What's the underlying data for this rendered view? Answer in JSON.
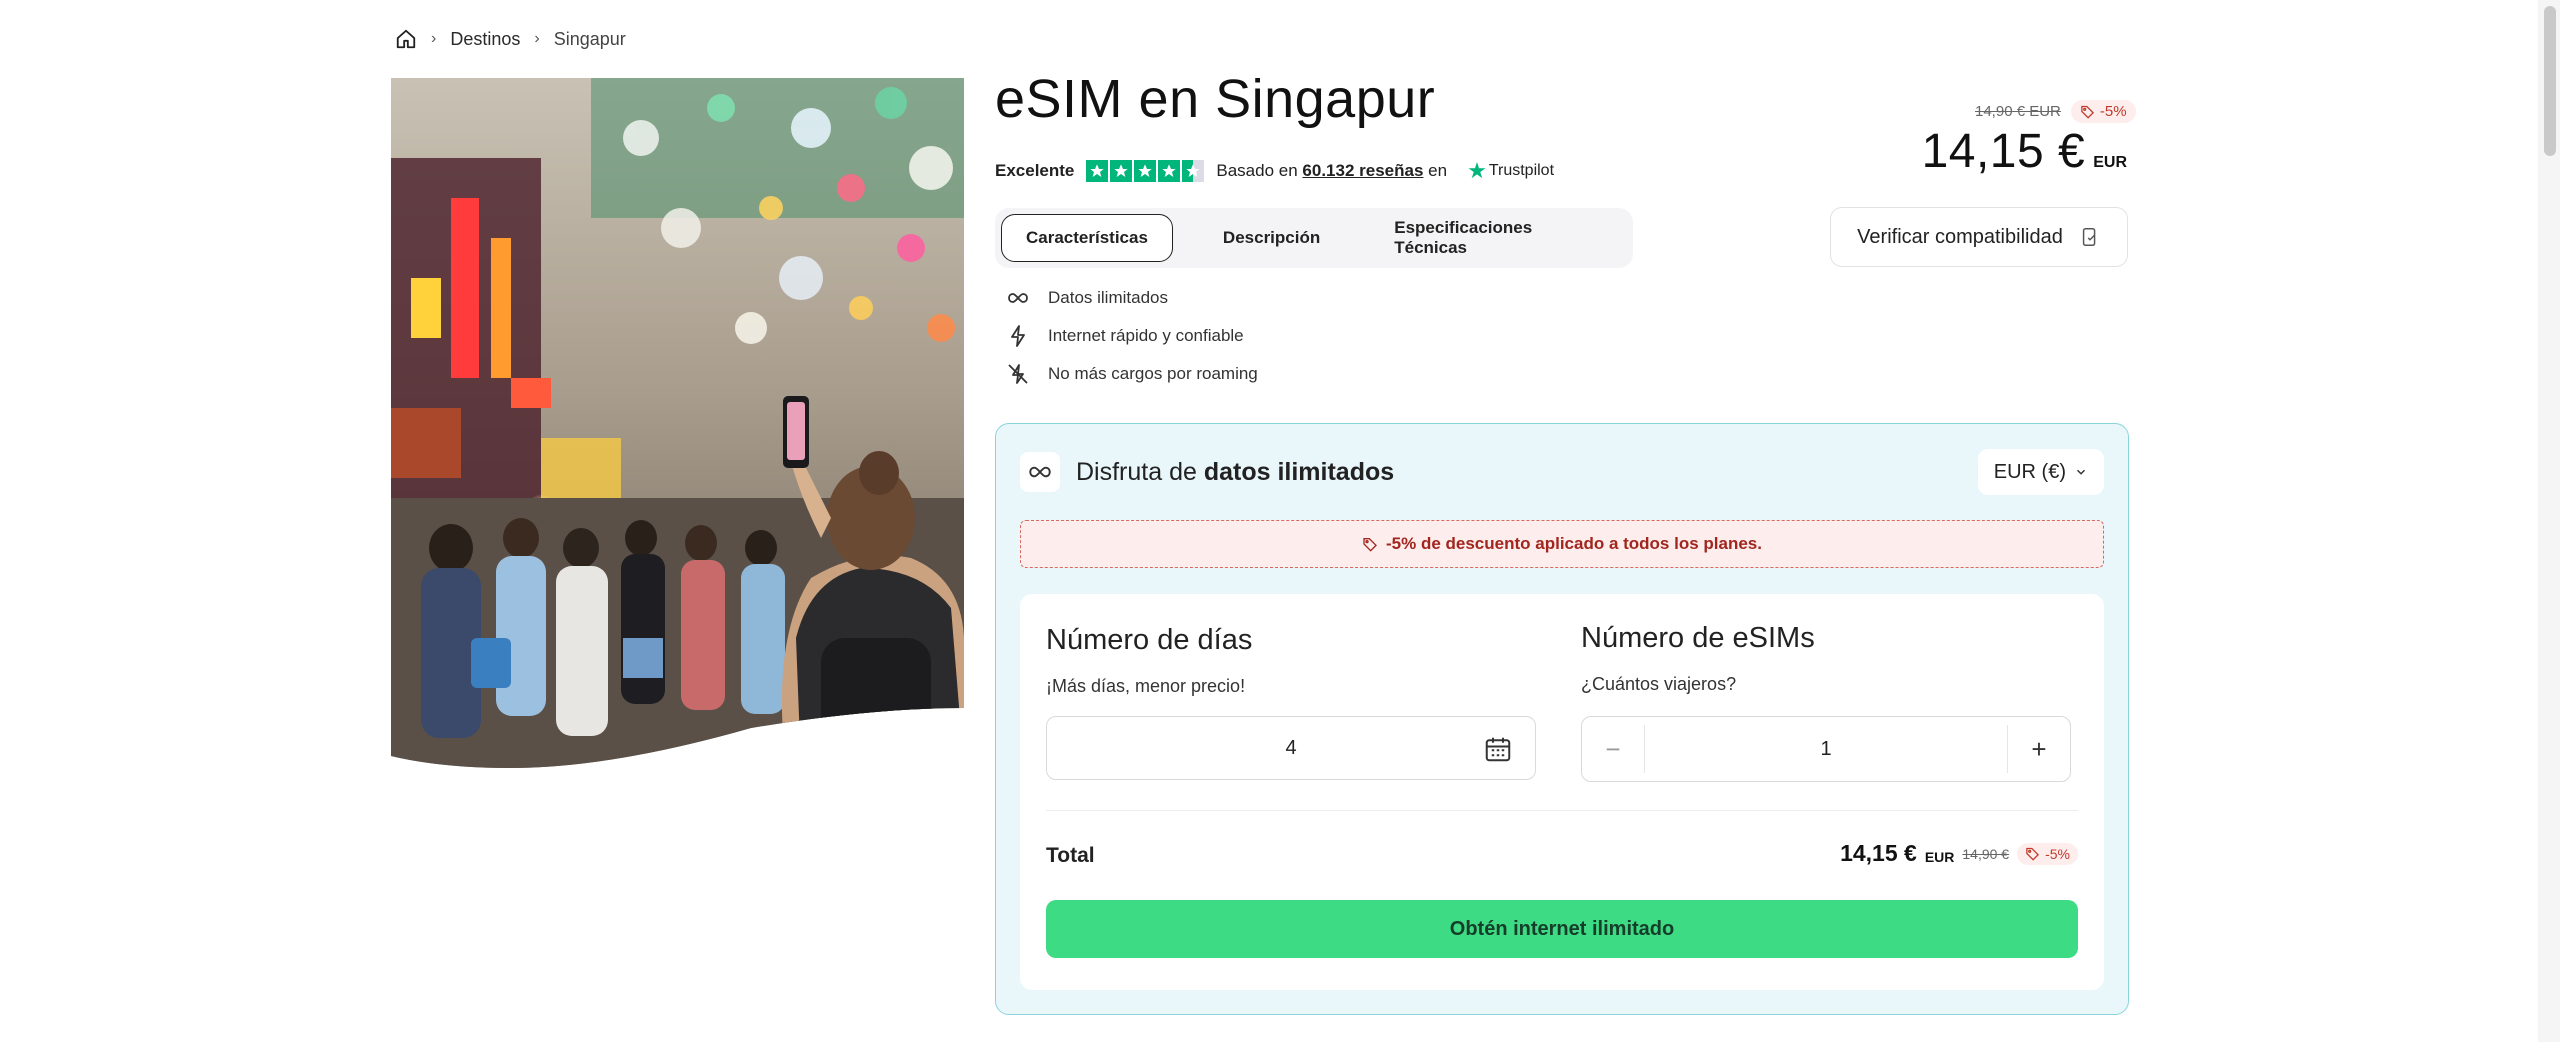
{
  "breadcrumb": {
    "home_icon": "home-icon",
    "items": [
      "Destinos",
      "Singapur"
    ]
  },
  "product": {
    "title": "eSIM en Singapur",
    "rating_label": "Excelente",
    "rating_stars": 4.5,
    "reviews_prefix": "Basado en",
    "reviews_count": "60.132 reseñas",
    "reviews_suffix": "en",
    "trustpilot": "Trustpilot",
    "old_price": "14,90 € EUR",
    "discount_badge": "-5%",
    "price": "14,15 €",
    "price_currency": "EUR"
  },
  "tabs": [
    {
      "label": "Características",
      "active": true
    },
    {
      "label": "Descripción",
      "active": false
    },
    {
      "label": "Especificaciones Técnicas",
      "active": false
    }
  ],
  "verify_button": "Verificar compatibilidad",
  "features": [
    {
      "icon": "infinity-icon",
      "label": "Datos ilimitados"
    },
    {
      "icon": "lightning-icon",
      "label": "Internet rápido y confiable"
    },
    {
      "icon": "no-roaming-icon",
      "label": "No más cargos por roaming"
    }
  ],
  "plan_card": {
    "heading_prefix": "Disfruta de",
    "heading_bold": "datos ilimitados",
    "currency_select": "EUR (€)",
    "discount_notice": "-5% de descuento aplicado a todos los planes.",
    "days": {
      "title": "Número de días",
      "subtitle": "¡Más días, menor precio!",
      "value": "4"
    },
    "esims": {
      "title": "Número de eSIMs",
      "subtitle": "¿Cuántos viajeros?",
      "value": "1",
      "minus": "−",
      "plus": "+"
    },
    "total": {
      "label": "Total",
      "amount": "14,15 €",
      "currency": "EUR",
      "old": "14,90 €",
      "badge": "-5%"
    },
    "cta": "Obtén internet ilimitado"
  },
  "colors": {
    "accent_green": "#3ddc84",
    "card_bg": "#e9f7fa",
    "card_border": "#8ad5dd",
    "discount_red": "#c0392b",
    "trustpilot_green": "#00b67a"
  }
}
